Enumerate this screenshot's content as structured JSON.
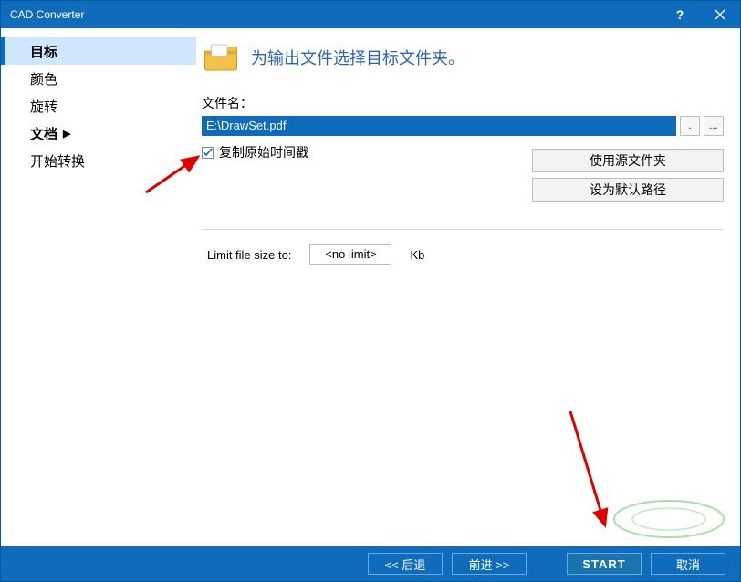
{
  "titlebar": {
    "title": "CAD Converter"
  },
  "sidebar": {
    "items": [
      {
        "label": "目标",
        "selected": true,
        "has_chevron": false,
        "bold": true
      },
      {
        "label": "颜色",
        "selected": false,
        "has_chevron": false,
        "bold": false
      },
      {
        "label": "旋转",
        "selected": false,
        "has_chevron": false,
        "bold": false
      },
      {
        "label": "文档",
        "selected": false,
        "has_chevron": true,
        "bold": true
      },
      {
        "label": "开始转换",
        "selected": false,
        "has_chevron": false,
        "bold": false
      }
    ]
  },
  "content": {
    "heading": "为输出文件选择目标文件夹。",
    "filename_label": "文件名：",
    "filepath_value": "E:\\DrawSet.pdf",
    "compact_btn_label": ".",
    "browse_btn_label": "...",
    "checkbox_label": "复制原始时间戳",
    "checkbox_checked": true,
    "btn_use_source": "使用源文件夹",
    "btn_set_default": "设为默认路径",
    "limit_label": "Limit file size to:",
    "limit_value": "<no limit>",
    "limit_unit": "Kb"
  },
  "bottom": {
    "back": "<< 后退",
    "forward": "前进 >>",
    "start": "START",
    "cancel": "取消"
  }
}
